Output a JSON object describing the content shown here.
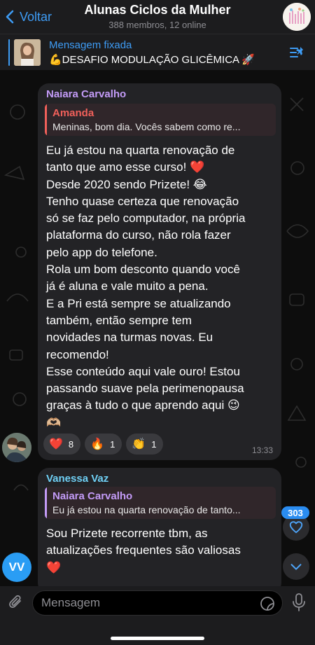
{
  "header": {
    "back_label": "Voltar",
    "title": "Alunas Ciclos da Mulher",
    "subtitle": "388 membros, 12 online"
  },
  "pinned": {
    "title": "Mensagem fixada",
    "text": "💪DESAFIO MODULAÇÃO GLICÊMICA 🚀"
  },
  "messages": [
    {
      "sender": "Naiara Carvalho",
      "sender_color": "#c39bf7",
      "reply": {
        "name": "Amanda",
        "name_color": "#f0605a",
        "text": "Meninas, bom dia. Vocês sabem como re..."
      },
      "lines": [
        "Eu já estou na quarta renovação de",
        "tanto que amo esse curso! ❤️",
        "Desde 2020 sendo Prizete! 😂",
        "Tenho quase certeza que renovação",
        "só se faz pelo computador, na própria",
        "plataforma do curso, não rola fazer",
        "pelo app do telefone.",
        "Rola um bom desconto quando você",
        "já é aluna e vale muito a pena.",
        "E a Pri está sempre se atualizando",
        "também, então sempre tem",
        "novidades na turmas novas. Eu",
        "recomendo!",
        "Esse conteúdo aqui vale ouro! Estou",
        "passando suave pela perimenopausa",
        "graças à tudo o que aprendo aqui 😉",
        "🫶🏼"
      ],
      "reactions": [
        {
          "emoji": "❤️",
          "count": "8"
        },
        {
          "emoji": "🔥",
          "count": "1"
        },
        {
          "emoji": "👏",
          "count": "1"
        }
      ],
      "time": "13:33"
    },
    {
      "sender": "Vanessa Vaz",
      "sender_color": "#6fd0f5",
      "avatar_initials": "VV",
      "reply": {
        "name": "Naiara Carvalho",
        "name_color": "#c39bf7",
        "text": "Eu já estou na quarta renovação de tanto..."
      },
      "lines": [
        "Sou Prizete recorrente tbm, as",
        "atualizações frequentes são valiosas",
        "❤️"
      ]
    }
  ],
  "side": {
    "reactions_badge": "303"
  },
  "composer": {
    "placeholder": "Mensagem"
  },
  "colors": {
    "accent": "#3e9cf5",
    "bubble": "#232326",
    "badge": "#2a8cf0"
  }
}
